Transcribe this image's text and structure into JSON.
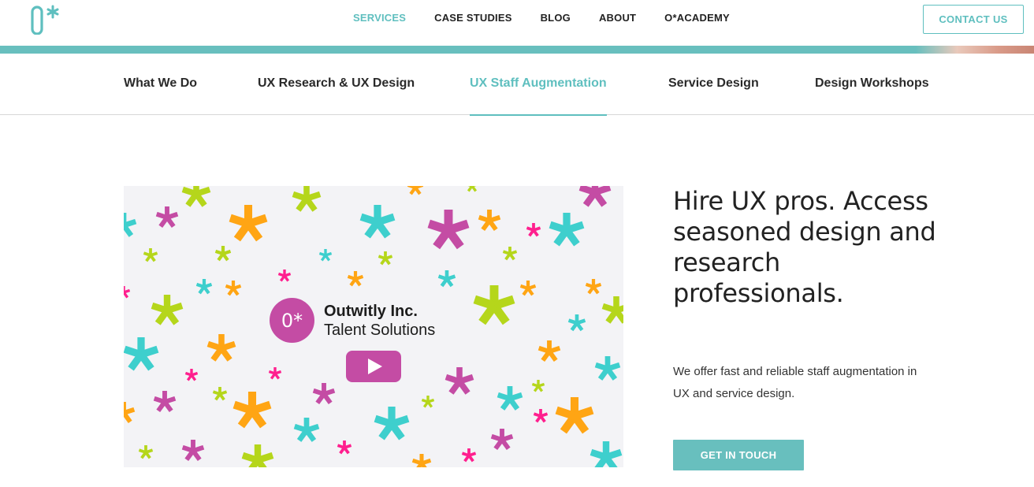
{
  "header": {
    "logo_text": "0*",
    "nav": [
      {
        "label": "SERVICES",
        "active": true
      },
      {
        "label": "CASE STUDIES",
        "active": false
      },
      {
        "label": "BLOG",
        "active": false
      },
      {
        "label": "ABOUT",
        "active": false
      },
      {
        "label": "O*ACADEMY",
        "active": false
      }
    ],
    "contact_label": "CONTACT US"
  },
  "subnav": {
    "items": [
      {
        "label": "What We Do",
        "active": false
      },
      {
        "label": "UX Research & UX Design",
        "active": false
      },
      {
        "label": "UX Staff Augmentation",
        "active": true
      },
      {
        "label": "Service Design",
        "active": false
      },
      {
        "label": "Design Workshops",
        "active": false
      }
    ]
  },
  "video": {
    "brand_mark": "0*",
    "brand_line1": "Outwitly Inc.",
    "brand_line2": "Talent Solutions",
    "play_icon": "play-icon",
    "pattern_colors": [
      "#3ecfcd",
      "#ffa514",
      "#b5d61b",
      "#c44ca4",
      "#ff1f8e"
    ]
  },
  "hero": {
    "headline": "Hire UX pros. Access seasoned design and research professionals.",
    "description": "We offer fast and reliable staff augmentation in UX and service design.",
    "cta_label": "GET IN TOUCH"
  },
  "colors": {
    "accent": "#5fbfbf",
    "brand_magenta": "#c44ca4"
  }
}
